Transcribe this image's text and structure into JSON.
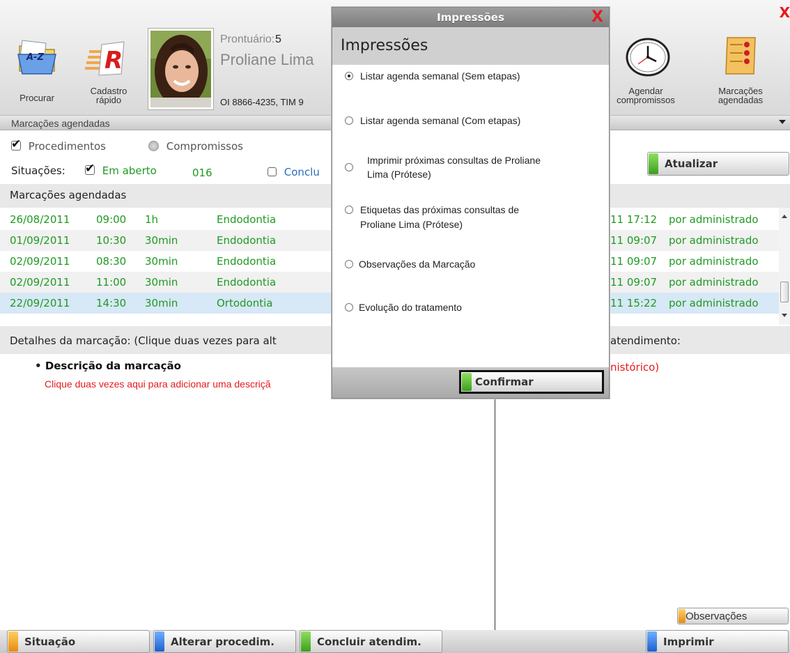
{
  "app": {
    "close_glyph": "X"
  },
  "toolbar": {
    "procurar": {
      "label": "Procurar",
      "icon": "folder-a-z-icon"
    },
    "cadastro": {
      "label_line1": "Cadastro",
      "label_line2": "rápido",
      "icon": "quick-register-r-icon"
    },
    "agendar": {
      "label_line1": "Agendar",
      "label_line2": "compromissos",
      "icon": "clock-icon"
    },
    "marcacoes": {
      "label_line1": "Marcações",
      "label_line2": "agendadas",
      "icon": "scheduled-list-icon"
    }
  },
  "patient": {
    "prontuario_label": "Prontuário:",
    "prontuario_value": "5",
    "name": "Proliane Lima",
    "phones": "OI 8866-4235, TIM 9"
  },
  "section_bar": {
    "title": "Marcações agendadas"
  },
  "filters": {
    "procedimentos": "Procedimentos",
    "compromissos": "Compromissos",
    "situacoes_label": "Situações:",
    "em_aberto": "Em aberto",
    "em_aberto_count": "016",
    "concluidos": "Conclu"
  },
  "atualizar_label": "Atualizar",
  "list": {
    "header": "Marcações agendadas",
    "rows": [
      {
        "date": "26/08/2011",
        "time": "09:00",
        "duration": "1h",
        "procedure": "Endodontia",
        "created": "11 17:12",
        "by": "por administrado"
      },
      {
        "date": "01/09/2011",
        "time": "10:30",
        "duration": "30min",
        "procedure": "Endodontia",
        "created": "11 09:07",
        "by": "por administrado"
      },
      {
        "date": "02/09/2011",
        "time": "08:30",
        "duration": "30min",
        "procedure": "Endodontia",
        "created": "11 09:07",
        "by": "por administrado"
      },
      {
        "date": "02/09/2011",
        "time": "11:00",
        "duration": "30min",
        "procedure": "Endodontia",
        "created": "11 09:07",
        "by": "por administrado"
      },
      {
        "date": "22/09/2011",
        "time": "14:30",
        "duration": "30min",
        "procedure": "Ortodontia",
        "created": "11 15:22",
        "by": "por administrado"
      }
    ]
  },
  "details": {
    "header_left": "Detalhes da marcação: (Clique duas vezes para alt",
    "header_right": "atendimento:",
    "descricao_title": "Descrição da marcação",
    "descricao_hint": "Clique duas vezes aqui para adicionar uma descriçã",
    "historico": "nistórico)"
  },
  "observacoes_label": "Observações",
  "bottom": {
    "situacao": "Situação",
    "alterar": "Alterar procedim.",
    "concluir": "Concluir atendim.",
    "imprimir": "Imprimir"
  },
  "modal": {
    "title": "Impressões",
    "heading": "Impressões",
    "close_glyph": "X",
    "options": [
      {
        "line1": "Listar agenda semanal (Sem etapas)",
        "line2": "",
        "selected": true
      },
      {
        "line1": "Listar agenda semanal (Com etapas)",
        "line2": "",
        "selected": false
      },
      {
        "line1": "Imprimir próximas consultas de Proliane",
        "line2": "Lima (Prótese)",
        "selected": false
      },
      {
        "line1": "Etiquetas das próximas consultas de",
        "line2": "Proliane Lima (Prótese)",
        "selected": false
      },
      {
        "line1": "Observações da Marcação",
        "line2": "",
        "selected": false
      },
      {
        "line1": "Evolução do tratamento",
        "line2": "",
        "selected": false
      }
    ],
    "confirm_label": "Confirmar"
  },
  "colors": {
    "green_text": "#1f9a22",
    "red_text": "#e8191d",
    "blue_link": "#2a6fb8",
    "accent_green": "#5fc234",
    "accent_blue": "#2f6fd6",
    "accent_orange": "#f0a020"
  }
}
